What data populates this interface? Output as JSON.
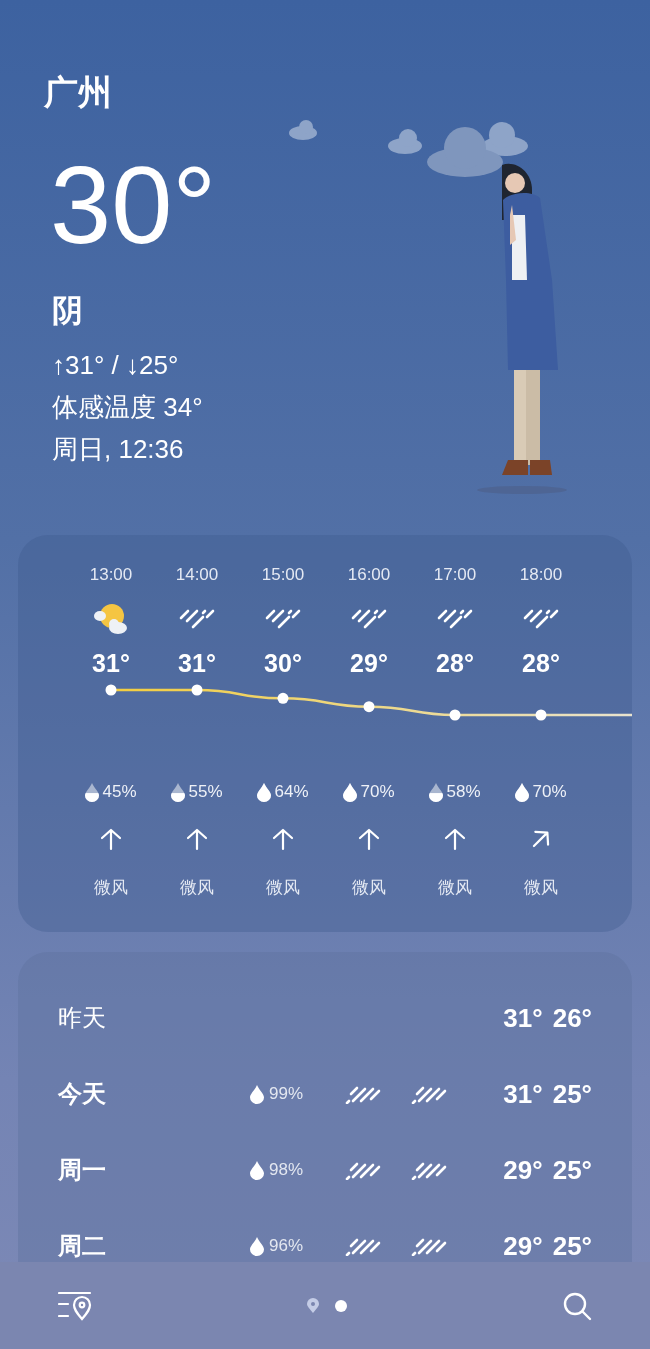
{
  "current": {
    "city": "广州",
    "temperature": "30°",
    "condition": "阴",
    "high_low": "↑31° / ↓25°",
    "feels_like": "体感温度 34°",
    "datetime": "周日, 12:36"
  },
  "hourly": [
    {
      "time": "13:00",
      "kind": "sun_cloud",
      "temp": "31°",
      "humidity": {
        "text": "45%",
        "kind": "half"
      },
      "wind": {
        "label": "微风",
        "kind": "north"
      }
    },
    {
      "time": "14:00",
      "kind": "rain",
      "temp": "31°",
      "humidity": {
        "text": "55%",
        "kind": "half"
      },
      "wind": {
        "label": "微风",
        "kind": "north"
      }
    },
    {
      "time": "15:00",
      "kind": "rain",
      "temp": "30°",
      "humidity": {
        "text": "64%",
        "kind": "full"
      },
      "wind": {
        "label": "微风",
        "kind": "north"
      }
    },
    {
      "time": "16:00",
      "kind": "rain",
      "temp": "29°",
      "humidity": {
        "text": "70%",
        "kind": "full"
      },
      "wind": {
        "label": "微风",
        "kind": "north"
      }
    },
    {
      "time": "17:00",
      "kind": "rain",
      "temp": "28°",
      "humidity": {
        "text": "58%",
        "kind": "half"
      },
      "wind": {
        "label": "微风",
        "kind": "north"
      }
    },
    {
      "time": "18:00",
      "kind": "rain",
      "temp": "28°",
      "humidity": {
        "text": "70%",
        "kind": "full"
      },
      "wind": {
        "label": "微风",
        "kind": "northeast"
      }
    }
  ],
  "daily": [
    {
      "day": "昨天",
      "high": "31°",
      "low": "26°"
    },
    {
      "day": "今天",
      "humidity": "99%",
      "icons": [
        {
          "kind": "rain"
        },
        {
          "kind": "rain"
        }
      ],
      "high": "31°",
      "low": "25°"
    },
    {
      "day": "周一",
      "humidity": "98%",
      "icons": [
        {
          "kind": "rain"
        },
        {
          "kind": "rain"
        }
      ],
      "high": "29°",
      "low": "25°"
    },
    {
      "day": "周二",
      "humidity": "96%",
      "icons": [
        {
          "kind": "rain"
        },
        {
          "kind": "rain"
        }
      ],
      "high": "29°",
      "low": "25°"
    }
  ],
  "pages": [
    {
      "kind": "location",
      "selected": false
    },
    {
      "kind": "dot",
      "selected": true
    }
  ]
}
